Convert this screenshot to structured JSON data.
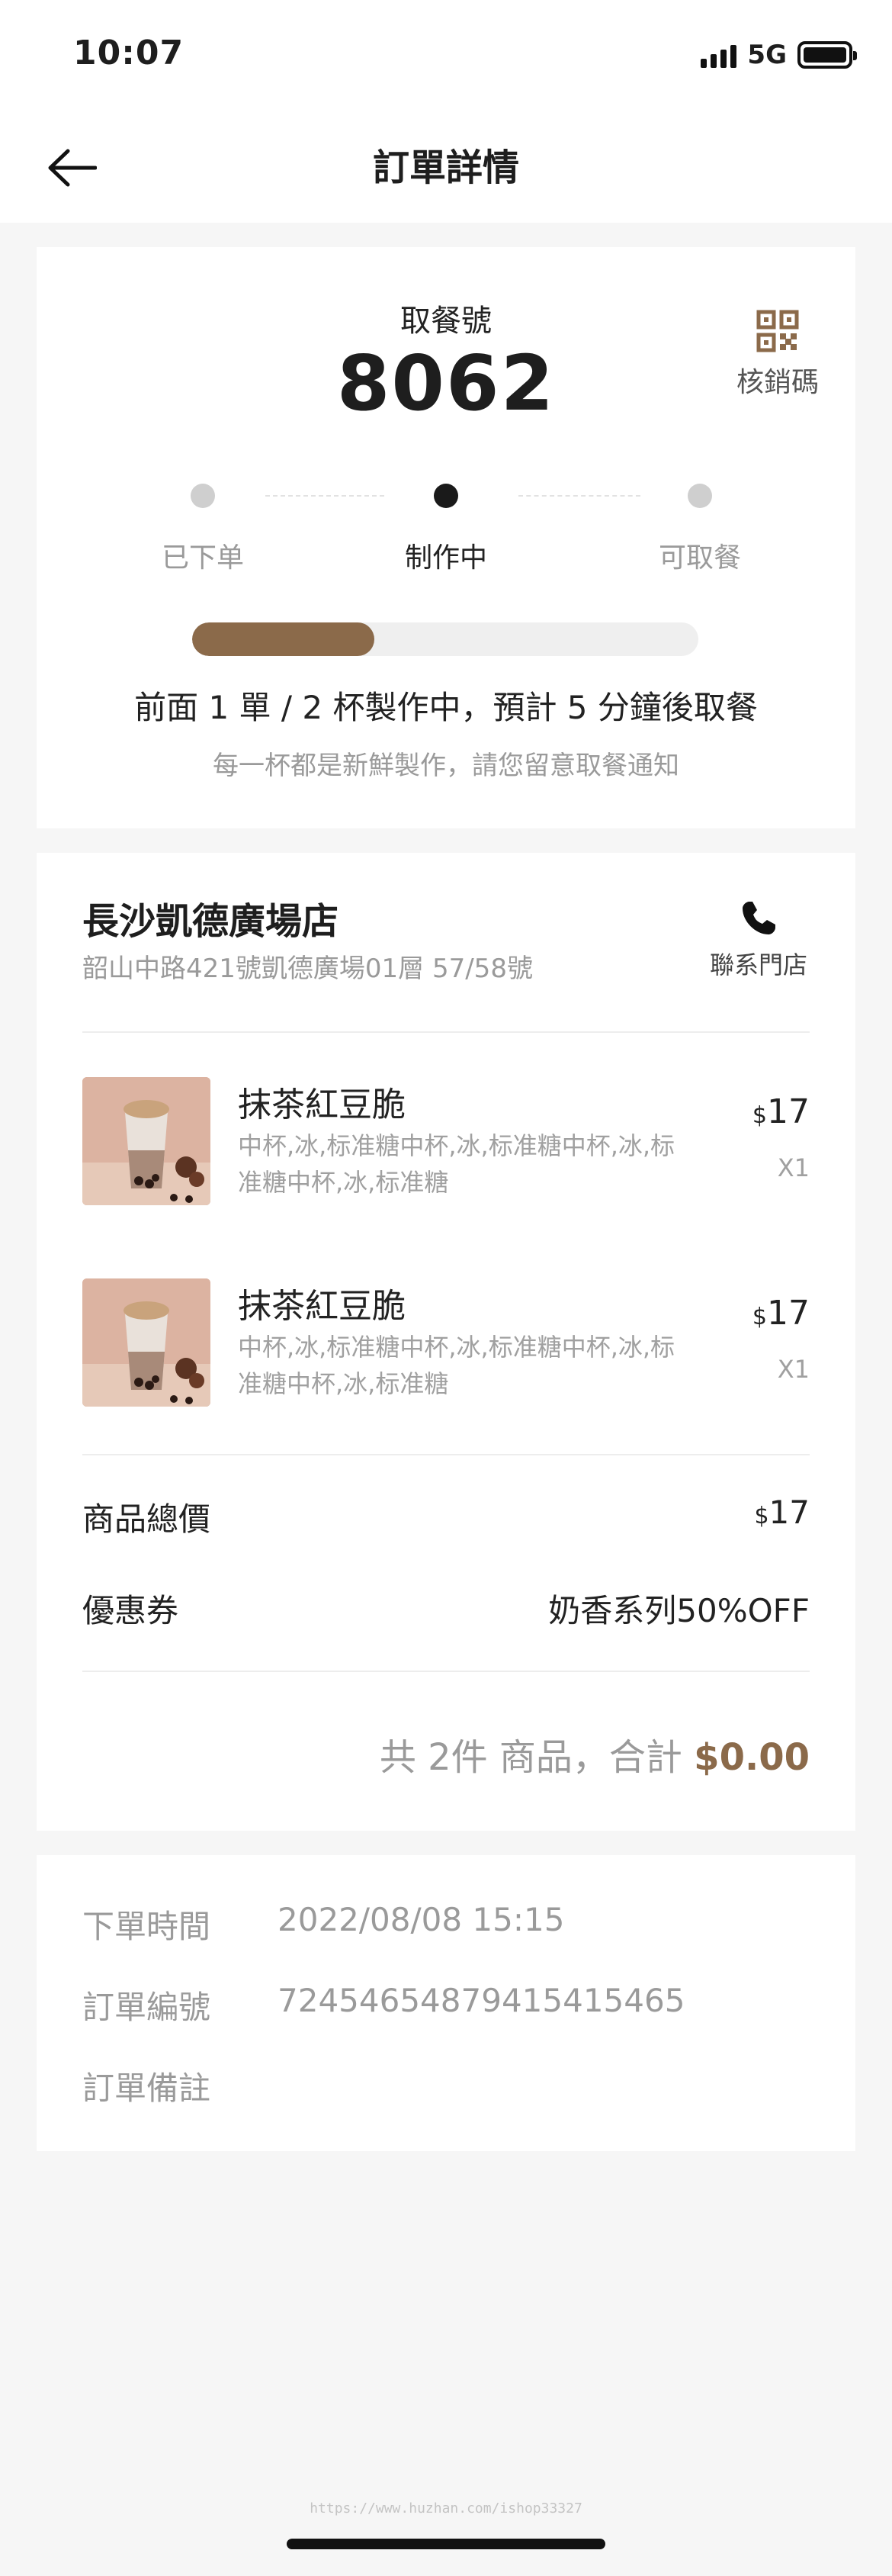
{
  "status_bar": {
    "time": "10:07",
    "network": "5G"
  },
  "nav": {
    "title": "訂單詳情"
  },
  "pickup": {
    "label": "取餐號",
    "number": "8062",
    "verify_label": "核銷碼",
    "steps": [
      "已下单",
      "制作中",
      "可取餐"
    ],
    "active_step": 1,
    "progress_fraction": 0.36,
    "queue_text": "前面 1 單 / 2 杯製作中，預計 5 分鐘後取餐",
    "queue_sub": "每一杯都是新鮮製作，請您留意取餐通知"
  },
  "store": {
    "name": "長沙凱德廣場店",
    "address": "韶山中路421號凱德廣場01層 57/58號",
    "contact_label": "聯系門店"
  },
  "items": [
    {
      "name": "抹茶紅豆脆",
      "desc": "中杯,冰,标准糖中杯,冰,标准糖中杯,冰,标准糖中杯,冰,标准糖",
      "currency": "$",
      "price": "17",
      "qty": "X1"
    },
    {
      "name": "抹茶紅豆脆",
      "desc": "中杯,冰,标准糖中杯,冰,标准糖中杯,冰,标准糖中杯,冰,标准糖",
      "currency": "$",
      "price": "17",
      "qty": "X1"
    }
  ],
  "summary": {
    "goods_total_label": "商品總價",
    "goods_total_currency": "$",
    "goods_total_value": "17",
    "coupon_label": "優惠券",
    "coupon_value": "奶香系列50%OFF",
    "total_prefix": "共 2件 商品，合計 ",
    "total_amount": "$0.00"
  },
  "order_info": {
    "time_label": "下單時間",
    "time_value": "2022/08/08 15:15",
    "number_label": "訂單編號",
    "number_value": "72454654879415415465",
    "note_label": "訂單備註"
  },
  "watermark": "https://www.huzhan.com/ishop33327",
  "colors": {
    "accent": "#8b6a4a",
    "background": "#f6f6f6",
    "muted": "#9a9a9a",
    "active_dot": "#1a1a1a",
    "inactive_dot": "#cfcfcf"
  }
}
